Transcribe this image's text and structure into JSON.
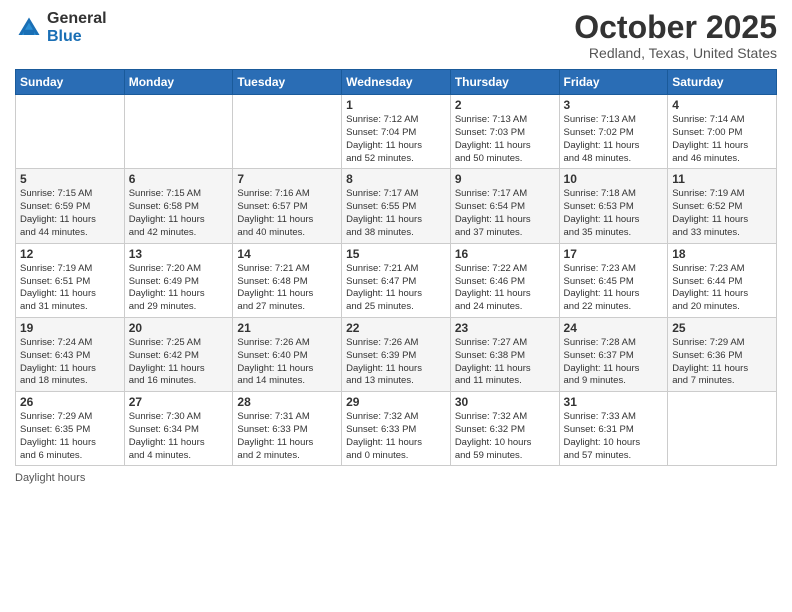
{
  "header": {
    "logo_general": "General",
    "logo_blue": "Blue",
    "month_title": "October 2025",
    "location": "Redland, Texas, United States"
  },
  "days_of_week": [
    "Sunday",
    "Monday",
    "Tuesday",
    "Wednesday",
    "Thursday",
    "Friday",
    "Saturday"
  ],
  "weeks": [
    [
      {
        "day": "",
        "info": ""
      },
      {
        "day": "",
        "info": ""
      },
      {
        "day": "",
        "info": ""
      },
      {
        "day": "1",
        "info": "Sunrise: 7:12 AM\nSunset: 7:04 PM\nDaylight: 11 hours\nand 52 minutes."
      },
      {
        "day": "2",
        "info": "Sunrise: 7:13 AM\nSunset: 7:03 PM\nDaylight: 11 hours\nand 50 minutes."
      },
      {
        "day": "3",
        "info": "Sunrise: 7:13 AM\nSunset: 7:02 PM\nDaylight: 11 hours\nand 48 minutes."
      },
      {
        "day": "4",
        "info": "Sunrise: 7:14 AM\nSunset: 7:00 PM\nDaylight: 11 hours\nand 46 minutes."
      }
    ],
    [
      {
        "day": "5",
        "info": "Sunrise: 7:15 AM\nSunset: 6:59 PM\nDaylight: 11 hours\nand 44 minutes."
      },
      {
        "day": "6",
        "info": "Sunrise: 7:15 AM\nSunset: 6:58 PM\nDaylight: 11 hours\nand 42 minutes."
      },
      {
        "day": "7",
        "info": "Sunrise: 7:16 AM\nSunset: 6:57 PM\nDaylight: 11 hours\nand 40 minutes."
      },
      {
        "day": "8",
        "info": "Sunrise: 7:17 AM\nSunset: 6:55 PM\nDaylight: 11 hours\nand 38 minutes."
      },
      {
        "day": "9",
        "info": "Sunrise: 7:17 AM\nSunset: 6:54 PM\nDaylight: 11 hours\nand 37 minutes."
      },
      {
        "day": "10",
        "info": "Sunrise: 7:18 AM\nSunset: 6:53 PM\nDaylight: 11 hours\nand 35 minutes."
      },
      {
        "day": "11",
        "info": "Sunrise: 7:19 AM\nSunset: 6:52 PM\nDaylight: 11 hours\nand 33 minutes."
      }
    ],
    [
      {
        "day": "12",
        "info": "Sunrise: 7:19 AM\nSunset: 6:51 PM\nDaylight: 11 hours\nand 31 minutes."
      },
      {
        "day": "13",
        "info": "Sunrise: 7:20 AM\nSunset: 6:49 PM\nDaylight: 11 hours\nand 29 minutes."
      },
      {
        "day": "14",
        "info": "Sunrise: 7:21 AM\nSunset: 6:48 PM\nDaylight: 11 hours\nand 27 minutes."
      },
      {
        "day": "15",
        "info": "Sunrise: 7:21 AM\nSunset: 6:47 PM\nDaylight: 11 hours\nand 25 minutes."
      },
      {
        "day": "16",
        "info": "Sunrise: 7:22 AM\nSunset: 6:46 PM\nDaylight: 11 hours\nand 24 minutes."
      },
      {
        "day": "17",
        "info": "Sunrise: 7:23 AM\nSunset: 6:45 PM\nDaylight: 11 hours\nand 22 minutes."
      },
      {
        "day": "18",
        "info": "Sunrise: 7:23 AM\nSunset: 6:44 PM\nDaylight: 11 hours\nand 20 minutes."
      }
    ],
    [
      {
        "day": "19",
        "info": "Sunrise: 7:24 AM\nSunset: 6:43 PM\nDaylight: 11 hours\nand 18 minutes."
      },
      {
        "day": "20",
        "info": "Sunrise: 7:25 AM\nSunset: 6:42 PM\nDaylight: 11 hours\nand 16 minutes."
      },
      {
        "day": "21",
        "info": "Sunrise: 7:26 AM\nSunset: 6:40 PM\nDaylight: 11 hours\nand 14 minutes."
      },
      {
        "day": "22",
        "info": "Sunrise: 7:26 AM\nSunset: 6:39 PM\nDaylight: 11 hours\nand 13 minutes."
      },
      {
        "day": "23",
        "info": "Sunrise: 7:27 AM\nSunset: 6:38 PM\nDaylight: 11 hours\nand 11 minutes."
      },
      {
        "day": "24",
        "info": "Sunrise: 7:28 AM\nSunset: 6:37 PM\nDaylight: 11 hours\nand 9 minutes."
      },
      {
        "day": "25",
        "info": "Sunrise: 7:29 AM\nSunset: 6:36 PM\nDaylight: 11 hours\nand 7 minutes."
      }
    ],
    [
      {
        "day": "26",
        "info": "Sunrise: 7:29 AM\nSunset: 6:35 PM\nDaylight: 11 hours\nand 6 minutes."
      },
      {
        "day": "27",
        "info": "Sunrise: 7:30 AM\nSunset: 6:34 PM\nDaylight: 11 hours\nand 4 minutes."
      },
      {
        "day": "28",
        "info": "Sunrise: 7:31 AM\nSunset: 6:33 PM\nDaylight: 11 hours\nand 2 minutes."
      },
      {
        "day": "29",
        "info": "Sunrise: 7:32 AM\nSunset: 6:33 PM\nDaylight: 11 hours\nand 0 minutes."
      },
      {
        "day": "30",
        "info": "Sunrise: 7:32 AM\nSunset: 6:32 PM\nDaylight: 10 hours\nand 59 minutes."
      },
      {
        "day": "31",
        "info": "Sunrise: 7:33 AM\nSunset: 6:31 PM\nDaylight: 10 hours\nand 57 minutes."
      },
      {
        "day": "",
        "info": ""
      }
    ]
  ],
  "footer": {
    "daylight_label": "Daylight hours"
  }
}
